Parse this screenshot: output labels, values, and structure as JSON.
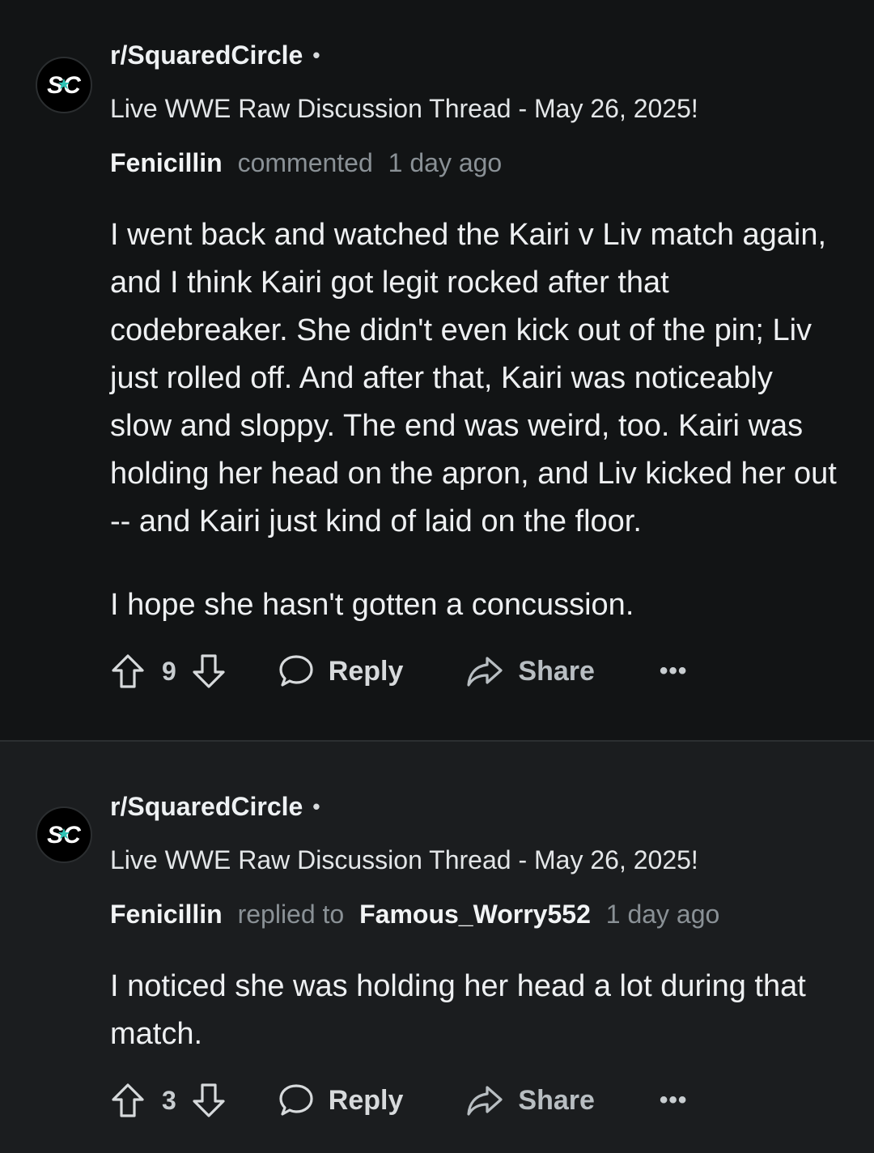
{
  "comments": [
    {
      "subreddit": "r/SquaredCircle",
      "separator": "•",
      "avatar_text": "SC",
      "thread_title": "Live WWE Raw Discussion Thread - May 26, 2025!",
      "author": "Fenicillin",
      "action": "commented",
      "reply_target": "",
      "time": "1 day ago",
      "paragraphs": [
        "I went back and watched the Kairi v Liv match again, and I think Kairi got legit rocked after that codebreaker. She didn't even kick out of the pin; Liv just rolled off. And after that, Kairi was noticeably slow and sloppy. The end was weird, too. Kairi was holding her head on the apron, and Liv kicked her out -- and Kairi just kind of laid on the floor.",
        "I hope she hasn't gotten a concussion."
      ],
      "votes": "9",
      "reply_label": "Reply",
      "share_label": "Share",
      "more_label": "•••"
    },
    {
      "subreddit": "r/SquaredCircle",
      "separator": "•",
      "avatar_text": "SC",
      "thread_title": "Live WWE Raw Discussion Thread - May 26, 2025!",
      "author": "Fenicillin",
      "action": "replied to",
      "reply_target": "Famous_Worry552",
      "time": "1 day ago",
      "paragraphs": [
        "I noticed she was holding her head a lot during that match."
      ],
      "votes": "3",
      "reply_label": "Reply",
      "share_label": "Share",
      "more_label": "•••"
    }
  ],
  "colors": {
    "background_top": "#121415",
    "background_bottom": "#1b1d1f",
    "text": "#eaeef0",
    "muted": "#8a9196",
    "avatar_accent": "#2ec4b6"
  },
  "icons": {
    "upvote": "upvote-arrow-icon",
    "downvote": "downvote-arrow-icon",
    "reply": "speech-bubble-icon",
    "share": "share-arrow-icon",
    "more": "ellipsis-icon"
  }
}
